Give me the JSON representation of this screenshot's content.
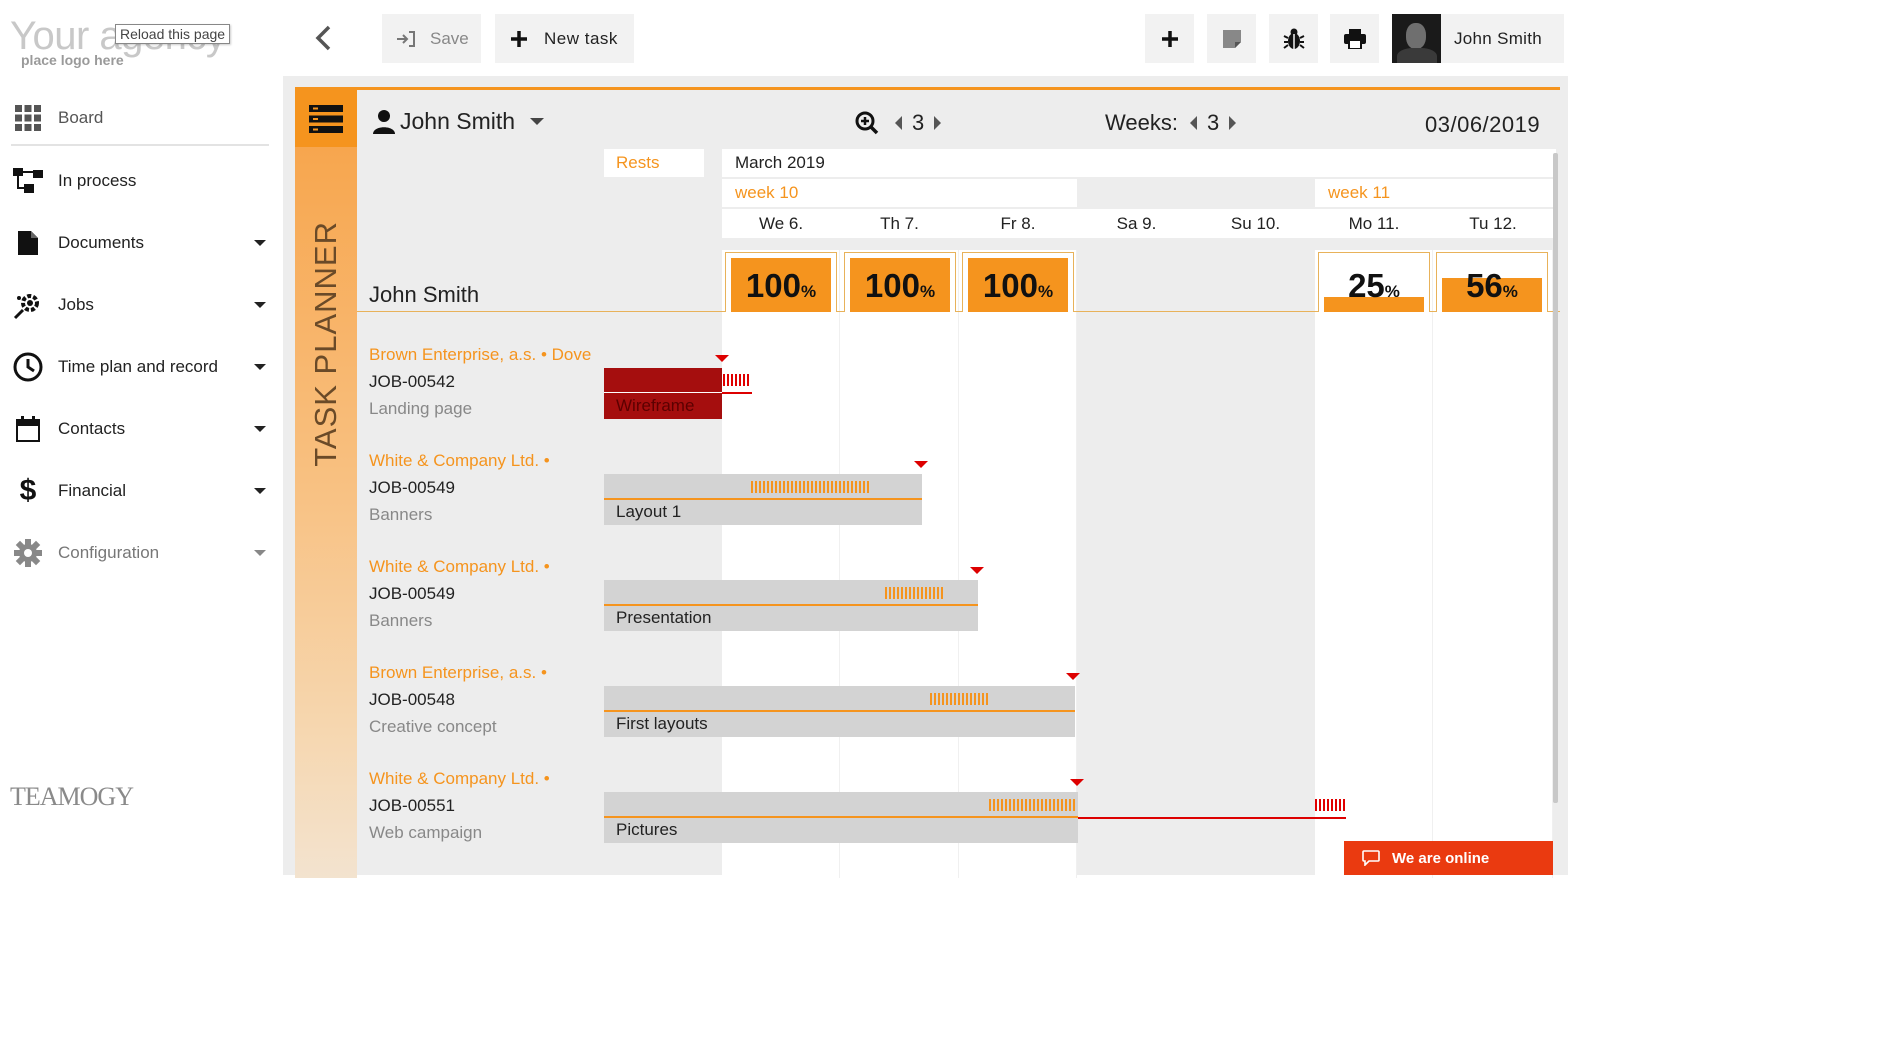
{
  "logo": {
    "text": "Your agency",
    "subtext": "place logo here",
    "tooltip": "Reload this page"
  },
  "sidebar": {
    "items": [
      {
        "label": "Board",
        "icon": "grid-icon"
      },
      {
        "label": "In process",
        "icon": "process-icon"
      },
      {
        "label": "Documents",
        "icon": "document-icon"
      },
      {
        "label": "Jobs",
        "icon": "jobs-icon"
      },
      {
        "label": "Time plan and record",
        "icon": "clock-icon"
      },
      {
        "label": "Contacts",
        "icon": "calendar-icon"
      },
      {
        "label": "Financial",
        "icon": "dollar-icon"
      },
      {
        "label": "Configuration",
        "icon": "gear-icon"
      }
    ]
  },
  "brand": {
    "name": "TEAMOGY"
  },
  "toolbar": {
    "save_label": "Save",
    "new_task_label": "New task",
    "user_name": "John Smith"
  },
  "planner": {
    "title": "TASK PLANNER",
    "selected_user": "John Smith",
    "zoom_value": "3",
    "weeks_label": "Weeks:",
    "weeks_value": "3",
    "date": "03/06/2019",
    "rests_label": "Rests",
    "month": "March 2019",
    "weeks": [
      "week 10",
      "week 11"
    ],
    "days": [
      "We 6.",
      "Th 7.",
      "Fr 8.",
      "Sa 9.",
      "Su 10.",
      "Mo 11.",
      "Tu 12."
    ],
    "row_user": "John Smith",
    "loads": [
      {
        "value": "100",
        "unit": "%",
        "fill": 1.0
      },
      {
        "value": "100",
        "unit": "%",
        "fill": 1.0
      },
      {
        "value": "100",
        "unit": "%",
        "fill": 1.0
      },
      {
        "value": "25",
        "unit": "%",
        "fill": 0.25
      },
      {
        "value": "56",
        "unit": "%",
        "fill": 0.56
      }
    ],
    "jobs": [
      {
        "client": "Brown Enterprise, a.s. • Dove",
        "code": "JOB-00542",
        "desc": "Landing page",
        "task": "Wireframe"
      },
      {
        "client": "White & Company Ltd. •",
        "code": "JOB-00549",
        "desc": "Banners",
        "task": "Layout 1"
      },
      {
        "client": "White & Company Ltd. •",
        "code": "JOB-00549",
        "desc": "Banners",
        "task": "Presentation"
      },
      {
        "client": "Brown Enterprise, a.s. •",
        "code": "JOB-00548",
        "desc": "Creative concept",
        "task": "First layouts"
      },
      {
        "client": "White & Company Ltd. •",
        "code": "JOB-00551",
        "desc": "Web campaign",
        "task": "Pictures"
      }
    ]
  },
  "chat": {
    "label": "We are online"
  },
  "colors": {
    "accent": "#f5941e",
    "danger": "#a50e0e",
    "chat": "#ea3a10"
  }
}
